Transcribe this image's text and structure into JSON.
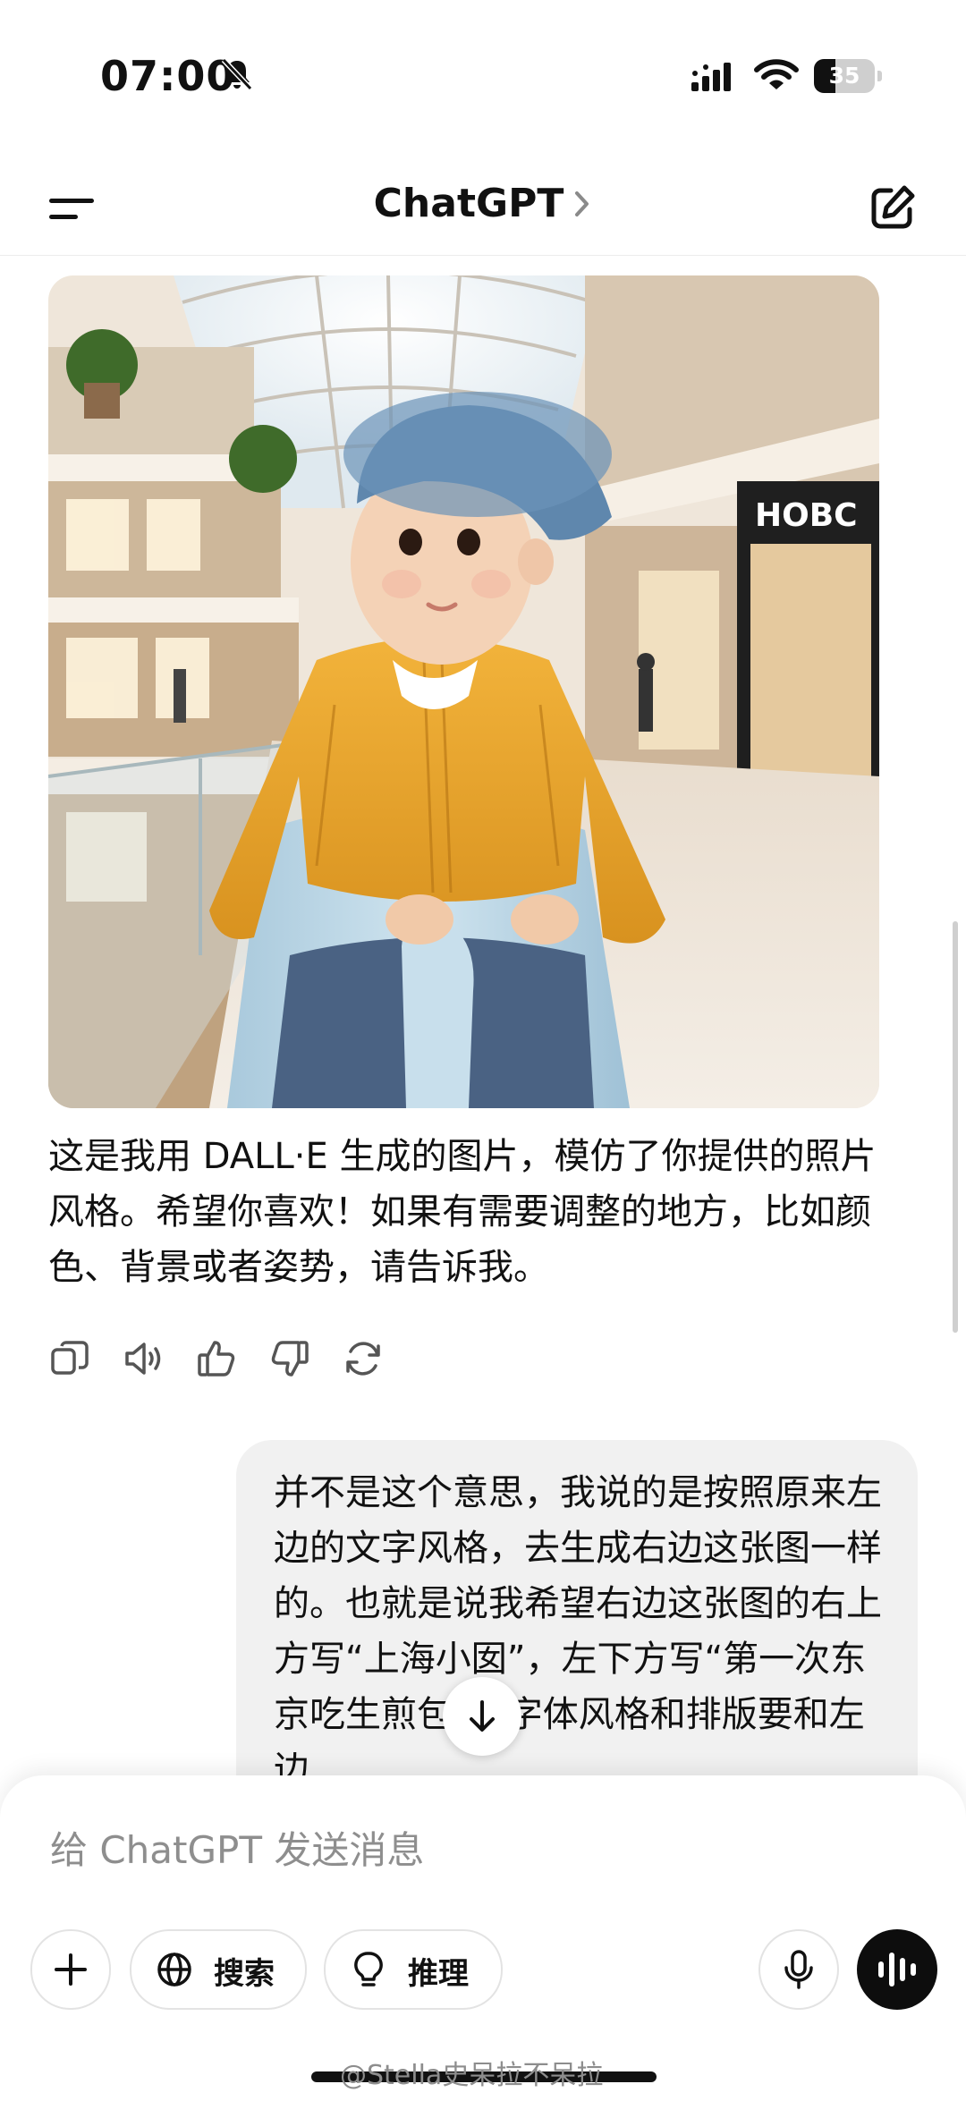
{
  "status_bar": {
    "time": "07:00",
    "battery_level": "35",
    "battery_fraction": 0.35,
    "icons": [
      "bell-slash-icon",
      "cellular-signal-icon",
      "wifi-icon",
      "battery-icon"
    ]
  },
  "header": {
    "title": "ChatGPT",
    "icons": [
      "menu-icon",
      "chevron-right-icon",
      "new-chat-icon"
    ]
  },
  "conversation": {
    "assistant_message": {
      "image_caption": "",
      "text": "这是我用 DALL·E 生成的图片，模仿了你提供的照片风格。希望你喜欢！如果有需要调整的地方，比如颜色、背景或者姿势，请告诉我。",
      "action_icons": [
        "copy-icon",
        "read-aloud-icon",
        "thumbs-up-icon",
        "thumbs-down-icon",
        "regenerate-icon"
      ],
      "image_sign_text": "HOBC"
    },
    "user_message": {
      "text": "并不是这个意思，我说的是按照原来左边的文字风格，去生成右边这张图一样的。也就是说我希望右边这张图的右上方写“上海小囡”，左下方写“第一次东京吃生煎包”，字体风格和排版要和左边"
    }
  },
  "composer": {
    "placeholder": "给 ChatGPT 发送消息",
    "search_label": "搜索",
    "reason_label": "推理",
    "icons": [
      "plus-icon",
      "globe-icon",
      "lightbulb-icon",
      "microphone-icon",
      "voice-mode-icon"
    ]
  },
  "watermark": "@Stella史呆拉不呆拉",
  "colors": {
    "text": "#111111",
    "bubble": "#f1f1f1",
    "placeholder": "#8e8e8e",
    "voice_button": "#0d0d0d"
  }
}
